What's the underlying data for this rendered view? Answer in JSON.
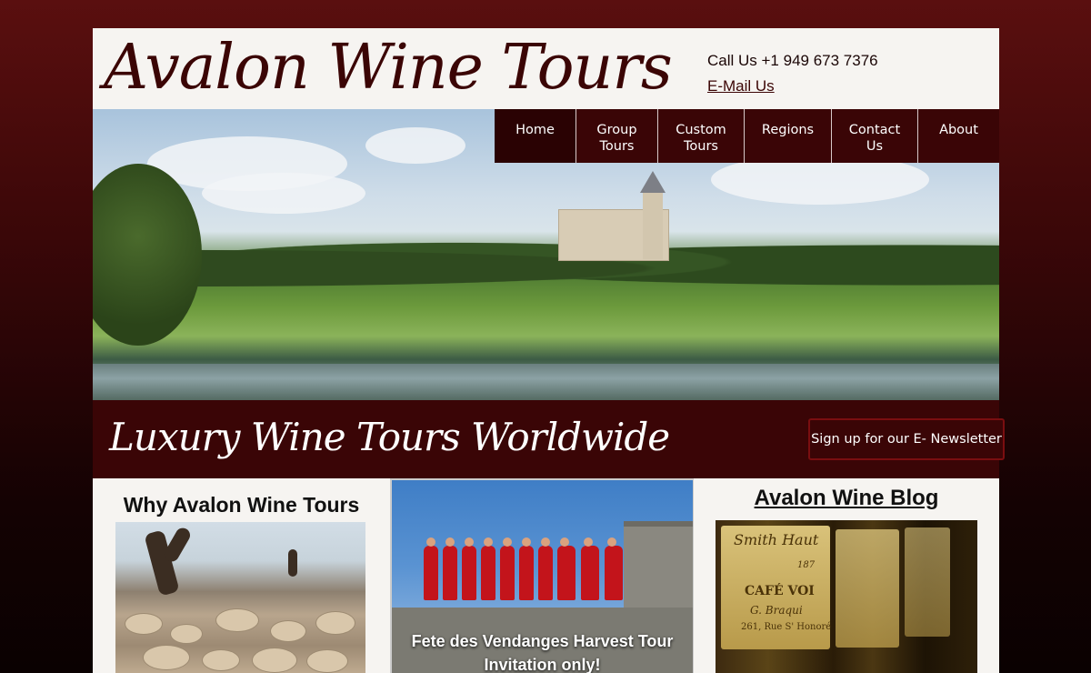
{
  "header": {
    "logo": "Avalon Wine Tours",
    "phone": "Call Us +1 949 673 7376",
    "email": "E-Mail Us"
  },
  "nav": {
    "items": [
      {
        "line1": "Home",
        "line2": "",
        "active": true
      },
      {
        "line1": "Group",
        "line2": "Tours",
        "active": false
      },
      {
        "line1": "Custom",
        "line2": "Tours",
        "active": false
      },
      {
        "line1": "Regions",
        "line2": "",
        "active": false
      },
      {
        "line1": "Contact",
        "line2": "Us",
        "active": false
      },
      {
        "line1": "About",
        "line2": "",
        "active": false
      }
    ]
  },
  "banner": {
    "tagline": "Luxury Wine Tours Worldwide",
    "newsletter_label": "Sign up for our E- Newsletter"
  },
  "columns": {
    "why_title": "Why Avalon Wine Tours",
    "feature_caption_1": "Fete des Vendanges Harvest Tour",
    "feature_caption_2": "Invitation only!",
    "blog_title": "Avalon Wine Blog"
  },
  "blog_image_text": {
    "line1": "Smith Haut",
    "line2": "187",
    "line3": "CAFÉ VOI",
    "line4": "G. Braqui",
    "line5": "261, Rue S' Honoré"
  },
  "colors": {
    "brand": "#3a0506",
    "page_bg": "#f6f4f1"
  }
}
